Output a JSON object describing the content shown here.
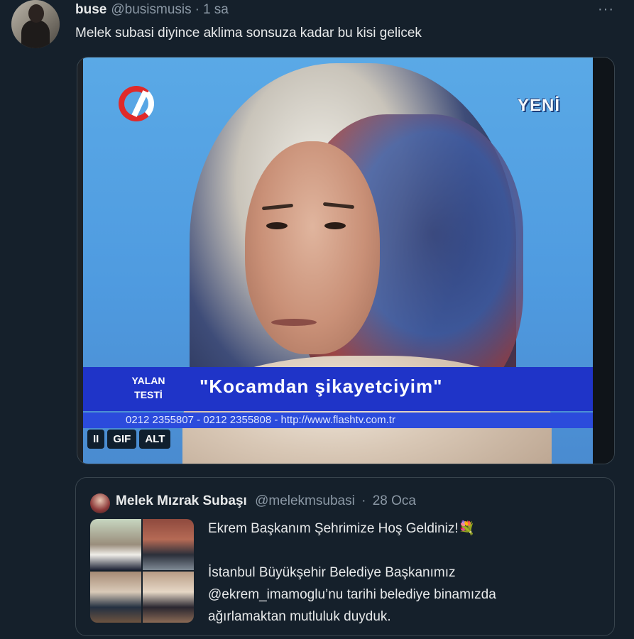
{
  "tweet": {
    "author_name": "buse",
    "author_handle": "@busismusis",
    "separator": "·",
    "time": "1 sa",
    "more_icon": "···",
    "text": "Melek subasi diyince aklima sonsuza kadar bu kisi gelicek"
  },
  "media": {
    "channel_badge": "YENİ",
    "lower_third_label_line1": "YALAN",
    "lower_third_label_line2": "TESTİ",
    "lower_third_quote": "\"Kocamdan şikayetciyim\"",
    "ticker_text": "0212 2355807 - 0212 2355808  -  http://www.flashtv.com.tr",
    "controls": {
      "pause_icon": "II",
      "gif_label": "GIF",
      "alt_label": "ALT"
    }
  },
  "quoted_tweet": {
    "author_name": "Melek Mızrak Subaşı",
    "author_handle": "@melekmsubasi",
    "separator": "·",
    "time": "28 Oca",
    "line1": "Ekrem Başkanım Şehrimize Hoş Geldiniz!",
    "emoji": "💐",
    "line2": "İstanbul Büyükşehir Belediye Başkanımız",
    "line3": "@ekrem_imamoglu’nu tarihi belediye binamızda",
    "line4": "ağırlamaktan mutluluk duyduk."
  },
  "colors": {
    "background": "#15202b",
    "text": "#e7e9ea",
    "muted": "#8b98a5",
    "border": "#38444d"
  }
}
